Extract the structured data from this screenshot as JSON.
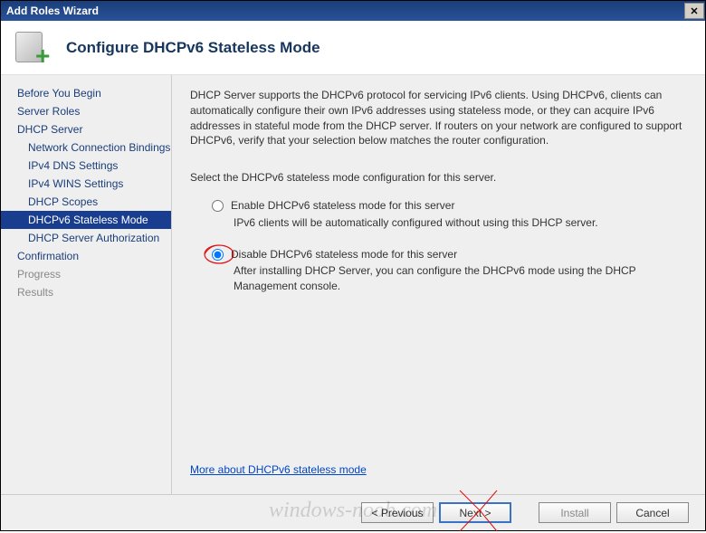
{
  "titlebar": {
    "title": "Add Roles Wizard",
    "close": "✕"
  },
  "header": {
    "page_title": "Configure DHCPv6 Stateless Mode"
  },
  "sidebar": {
    "items": [
      {
        "label": "Before You Begin",
        "sub": false,
        "selected": false,
        "disabled": false
      },
      {
        "label": "Server Roles",
        "sub": false,
        "selected": false,
        "disabled": false
      },
      {
        "label": "DHCP Server",
        "sub": false,
        "selected": false,
        "disabled": false
      },
      {
        "label": "Network Connection Bindings",
        "sub": true,
        "selected": false,
        "disabled": false
      },
      {
        "label": "IPv4 DNS Settings",
        "sub": true,
        "selected": false,
        "disabled": false
      },
      {
        "label": "IPv4 WINS Settings",
        "sub": true,
        "selected": false,
        "disabled": false
      },
      {
        "label": "DHCP Scopes",
        "sub": true,
        "selected": false,
        "disabled": false
      },
      {
        "label": "DHCPv6 Stateless Mode",
        "sub": true,
        "selected": true,
        "disabled": false
      },
      {
        "label": "DHCP Server Authorization",
        "sub": true,
        "selected": false,
        "disabled": false
      },
      {
        "label": "Confirmation",
        "sub": false,
        "selected": false,
        "disabled": false
      },
      {
        "label": "Progress",
        "sub": false,
        "selected": false,
        "disabled": true
      },
      {
        "label": "Results",
        "sub": false,
        "selected": false,
        "disabled": true
      }
    ]
  },
  "content": {
    "description": "DHCP Server supports the DHCPv6 protocol for servicing IPv6 clients. Using DHCPv6, clients can automatically configure their own IPv6 addresses using stateless mode, or they can acquire IPv6 addresses in stateful mode from the DHCP server. If routers on your network are configured to support DHCPv6, verify that your selection below matches the router configuration.",
    "prompt": "Select the DHCPv6 stateless mode configuration for this server.",
    "option_enable": {
      "label": "Enable DHCPv6 stateless mode for this server",
      "hint": "IPv6 clients will be automatically configured without using this DHCP server."
    },
    "option_disable": {
      "label": "Disable DHCPv6 stateless mode for this server",
      "hint": "After installing DHCP Server, you can configure the DHCPv6 mode using the DHCP Management console."
    },
    "selected_option": "disable",
    "learn_more": "More about DHCPv6 stateless mode"
  },
  "footer": {
    "previous": "< Previous",
    "next": "Next >",
    "install": "Install",
    "cancel": "Cancel"
  },
  "watermark": "windows-noob.com",
  "colors": {
    "title_gradient_top": "#1a3e7a",
    "title_gradient_bottom": "#2a5298",
    "selected_bg": "#1a3e8f",
    "link": "#0046c8",
    "pen": "#d11"
  }
}
